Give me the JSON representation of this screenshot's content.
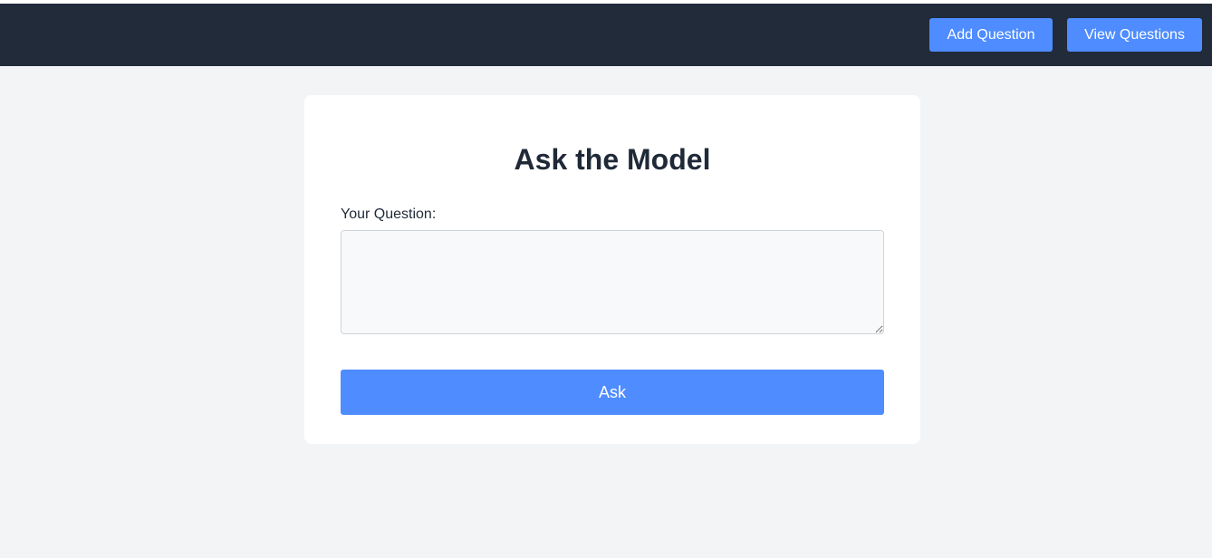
{
  "nav": {
    "add_question_label": "Add Question",
    "view_questions_label": "View Questions"
  },
  "form": {
    "title": "Ask the Model",
    "question_label": "Your Question:",
    "question_value": "",
    "question_placeholder": "",
    "submit_label": "Ask"
  },
  "colors": {
    "topbar": "#212b3a",
    "accent": "#4e8cff",
    "page_background": "#f3f4f6",
    "card": "#ffffff"
  }
}
